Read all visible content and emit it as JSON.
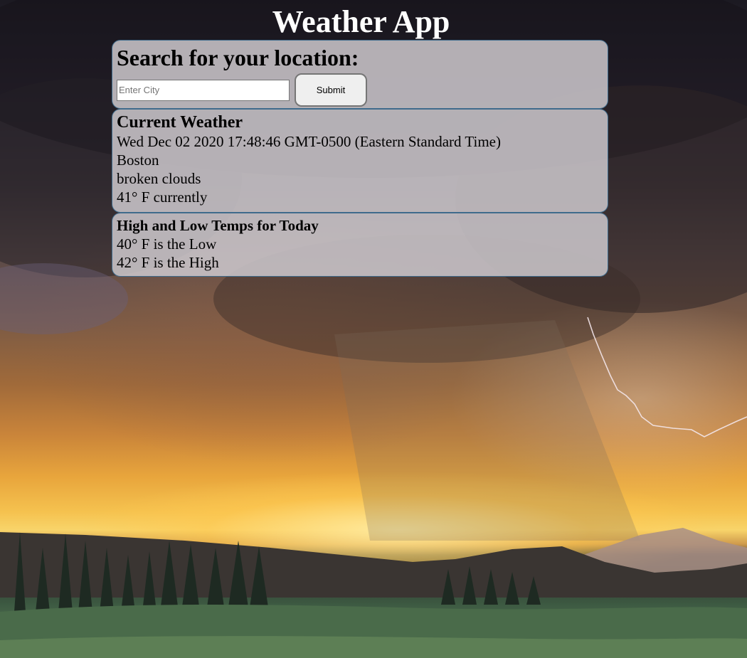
{
  "app": {
    "title": "Weather App"
  },
  "search": {
    "heading": "Search for your location:",
    "input_placeholder": "Enter City",
    "input_value": "",
    "submit_label": "Submit"
  },
  "current": {
    "heading": "Current Weather",
    "datetime": "Wed Dec 02 2020 17:48:46 GMT-0500 (Eastern Standard Time)",
    "city": "Boston",
    "description": "broken clouds",
    "temperature": "41° F currently"
  },
  "hilo": {
    "heading": "High and Low Temps for Today",
    "low": "40° F is the Low",
    "high": "42° F is the High"
  },
  "colors": {
    "card_background": "#cdc8cd",
    "card_border": "#3f6b8c",
    "title_text": "#ffffff"
  }
}
